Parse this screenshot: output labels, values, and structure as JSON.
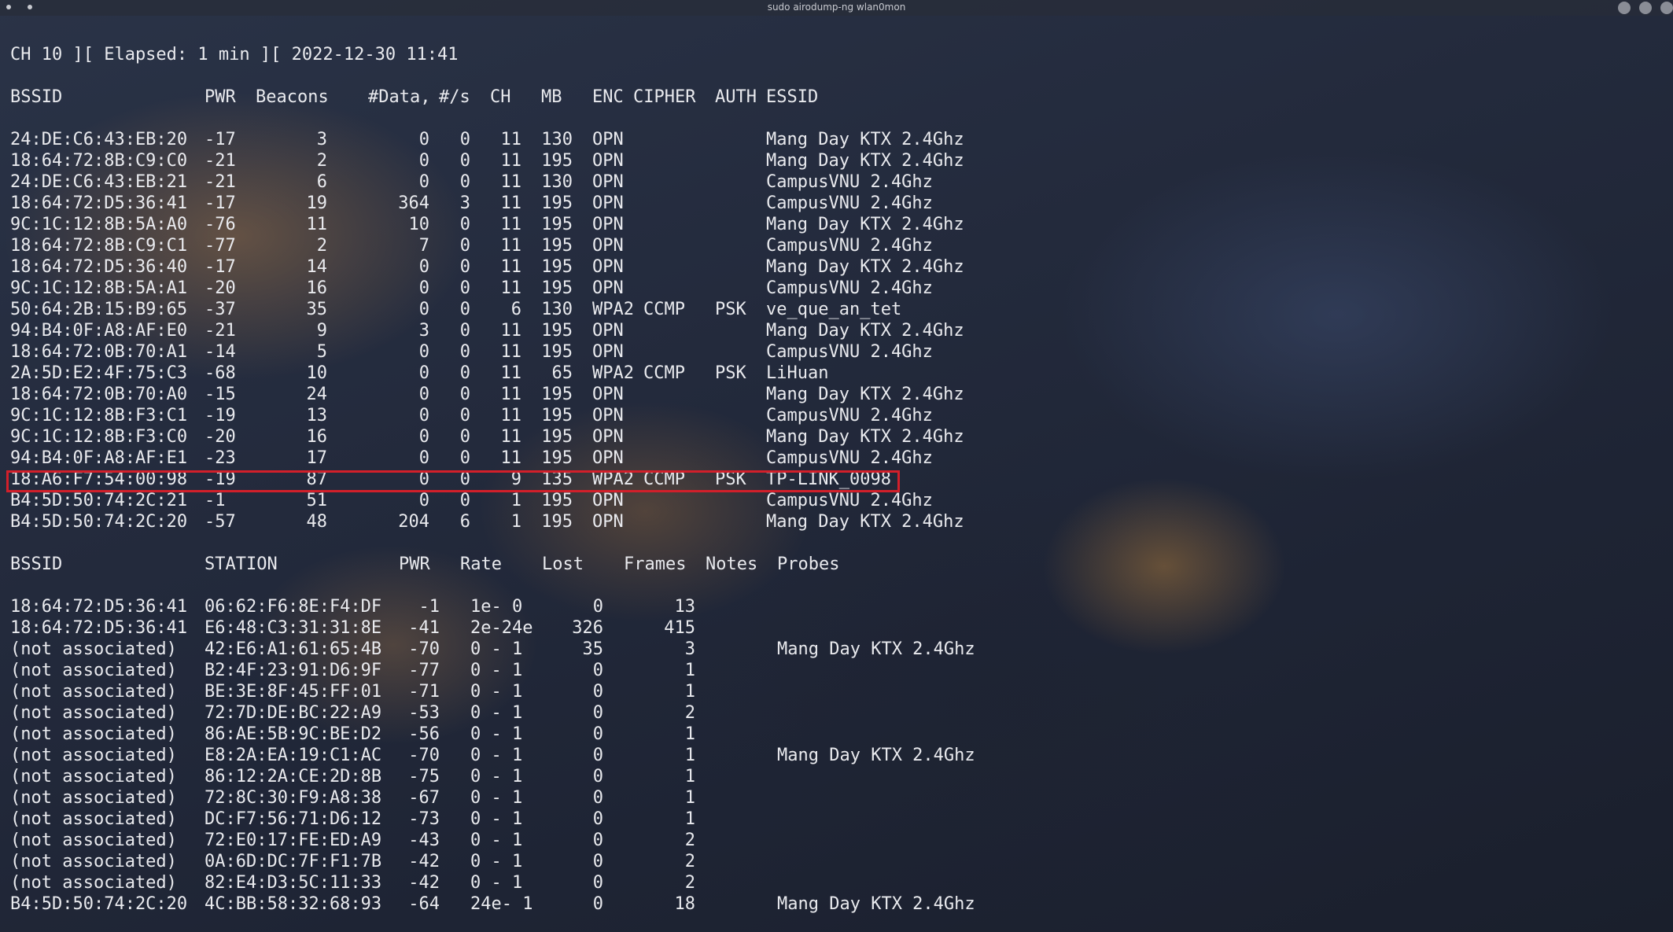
{
  "window": {
    "title": "sudo airodump-ng wlan0mon"
  },
  "status_line": "CH 10 ][ Elapsed: 1 min ][ 2022-12-30 11:41",
  "ap_table": {
    "headers": {
      "bssid": "BSSID",
      "pwr": "PWR",
      "beacons": "Beacons",
      "data": "#Data,",
      "per_sec": "#/s",
      "ch": "CH",
      "mb": "MB",
      "enc": "ENC",
      "cipher": "CIPHER",
      "auth": "AUTH",
      "essid": "ESSID"
    },
    "rows": [
      {
        "bssid": "24:DE:C6:43:EB:20",
        "pwr": "-17",
        "beacons": "3",
        "data": "0",
        "per_sec": "0",
        "ch": "11",
        "mb": "130",
        "enc": "OPN",
        "cipher": "",
        "auth": "",
        "essid": "Mang Day KTX 2.4Ghz"
      },
      {
        "bssid": "18:64:72:8B:C9:C0",
        "pwr": "-21",
        "beacons": "2",
        "data": "0",
        "per_sec": "0",
        "ch": "11",
        "mb": "195",
        "enc": "OPN",
        "cipher": "",
        "auth": "",
        "essid": "Mang Day KTX 2.4Ghz"
      },
      {
        "bssid": "24:DE:C6:43:EB:21",
        "pwr": "-21",
        "beacons": "6",
        "data": "0",
        "per_sec": "0",
        "ch": "11",
        "mb": "130",
        "enc": "OPN",
        "cipher": "",
        "auth": "",
        "essid": "CampusVNU 2.4Ghz"
      },
      {
        "bssid": "18:64:72:D5:36:41",
        "pwr": "-17",
        "beacons": "19",
        "data": "364",
        "per_sec": "3",
        "ch": "11",
        "mb": "195",
        "enc": "OPN",
        "cipher": "",
        "auth": "",
        "essid": "CampusVNU 2.4Ghz"
      },
      {
        "bssid": "9C:1C:12:8B:5A:A0",
        "pwr": "-76",
        "beacons": "11",
        "data": "10",
        "per_sec": "0",
        "ch": "11",
        "mb": "195",
        "enc": "OPN",
        "cipher": "",
        "auth": "",
        "essid": "Mang Day KTX 2.4Ghz"
      },
      {
        "bssid": "18:64:72:8B:C9:C1",
        "pwr": "-77",
        "beacons": "2",
        "data": "7",
        "per_sec": "0",
        "ch": "11",
        "mb": "195",
        "enc": "OPN",
        "cipher": "",
        "auth": "",
        "essid": "CampusVNU 2.4Ghz"
      },
      {
        "bssid": "18:64:72:D5:36:40",
        "pwr": "-17",
        "beacons": "14",
        "data": "0",
        "per_sec": "0",
        "ch": "11",
        "mb": "195",
        "enc": "OPN",
        "cipher": "",
        "auth": "",
        "essid": "Mang Day KTX 2.4Ghz"
      },
      {
        "bssid": "9C:1C:12:8B:5A:A1",
        "pwr": "-20",
        "beacons": "16",
        "data": "0",
        "per_sec": "0",
        "ch": "11",
        "mb": "195",
        "enc": "OPN",
        "cipher": "",
        "auth": "",
        "essid": "CampusVNU 2.4Ghz"
      },
      {
        "bssid": "50:64:2B:15:B9:65",
        "pwr": "-37",
        "beacons": "35",
        "data": "0",
        "per_sec": "0",
        "ch": "6",
        "mb": "130",
        "enc": "WPA2",
        "cipher": "CCMP",
        "auth": "PSK",
        "essid": "ve_que_an_tet"
      },
      {
        "bssid": "94:B4:0F:A8:AF:E0",
        "pwr": "-21",
        "beacons": "9",
        "data": "3",
        "per_sec": "0",
        "ch": "11",
        "mb": "195",
        "enc": "OPN",
        "cipher": "",
        "auth": "",
        "essid": "Mang Day KTX 2.4Ghz"
      },
      {
        "bssid": "18:64:72:0B:70:A1",
        "pwr": "-14",
        "beacons": "5",
        "data": "0",
        "per_sec": "0",
        "ch": "11",
        "mb": "195",
        "enc": "OPN",
        "cipher": "",
        "auth": "",
        "essid": "CampusVNU 2.4Ghz"
      },
      {
        "bssid": "2A:5D:E2:4F:75:C3",
        "pwr": "-68",
        "beacons": "10",
        "data": "0",
        "per_sec": "0",
        "ch": "11",
        "mb": "65",
        "enc": "WPA2",
        "cipher": "CCMP",
        "auth": "PSK",
        "essid": "LiHuan"
      },
      {
        "bssid": "18:64:72:0B:70:A0",
        "pwr": "-15",
        "beacons": "24",
        "data": "0",
        "per_sec": "0",
        "ch": "11",
        "mb": "195",
        "enc": "OPN",
        "cipher": "",
        "auth": "",
        "essid": "Mang Day KTX 2.4Ghz"
      },
      {
        "bssid": "9C:1C:12:8B:F3:C1",
        "pwr": "-19",
        "beacons": "13",
        "data": "0",
        "per_sec": "0",
        "ch": "11",
        "mb": "195",
        "enc": "OPN",
        "cipher": "",
        "auth": "",
        "essid": "CampusVNU 2.4Ghz"
      },
      {
        "bssid": "9C:1C:12:8B:F3:C0",
        "pwr": "-20",
        "beacons": "16",
        "data": "0",
        "per_sec": "0",
        "ch": "11",
        "mb": "195",
        "enc": "OPN",
        "cipher": "",
        "auth": "",
        "essid": "Mang Day KTX 2.4Ghz"
      },
      {
        "bssid": "94:B4:0F:A8:AF:E1",
        "pwr": "-23",
        "beacons": "17",
        "data": "0",
        "per_sec": "0",
        "ch": "11",
        "mb": "195",
        "enc": "OPN",
        "cipher": "",
        "auth": "",
        "essid": "CampusVNU 2.4Ghz"
      },
      {
        "bssid": "18:A6:F7:54:00:98",
        "pwr": "-19",
        "beacons": "87",
        "data": "0",
        "per_sec": "0",
        "ch": "9",
        "mb": "135",
        "enc": "WPA2",
        "cipher": "CCMP",
        "auth": "PSK",
        "essid": "TP-LINK_0098"
      },
      {
        "bssid": "B4:5D:50:74:2C:21",
        "pwr": "-1",
        "beacons": "51",
        "data": "0",
        "per_sec": "0",
        "ch": "1",
        "mb": "195",
        "enc": "OPN",
        "cipher": "",
        "auth": "",
        "essid": "CampusVNU 2.4Ghz"
      },
      {
        "bssid": "B4:5D:50:74:2C:20",
        "pwr": "-57",
        "beacons": "48",
        "data": "204",
        "per_sec": "6",
        "ch": "1",
        "mb": "195",
        "enc": "OPN",
        "cipher": "",
        "auth": "",
        "essid": "Mang Day KTX 2.4Ghz"
      }
    ]
  },
  "station_table": {
    "headers": {
      "bssid": "BSSID",
      "station": "STATION",
      "pwr": "PWR",
      "rate": "Rate",
      "lost": "Lost",
      "frames": "Frames",
      "notes": "Notes",
      "probes": "Probes"
    },
    "rows": [
      {
        "bssid": "18:64:72:D5:36:41",
        "station": "06:62:F6:8E:F4:DF",
        "pwr": "-1",
        "rate": "1e- 0",
        "lost": "0",
        "frames": "13",
        "probes": ""
      },
      {
        "bssid": "18:64:72:D5:36:41",
        "station": "E6:48:C3:31:31:8E",
        "pwr": "-41",
        "rate": "2e-24e",
        "lost": "326",
        "frames": "415",
        "probes": ""
      },
      {
        "bssid": "(not associated)",
        "station": "42:E6:A1:61:65:4B",
        "pwr": "-70",
        "rate": "0 - 1",
        "lost": "35",
        "frames": "3",
        "probes": "Mang Day KTX 2.4Ghz"
      },
      {
        "bssid": "(not associated)",
        "station": "B2:4F:23:91:D6:9F",
        "pwr": "-77",
        "rate": "0 - 1",
        "lost": "0",
        "frames": "1",
        "probes": ""
      },
      {
        "bssid": "(not associated)",
        "station": "BE:3E:8F:45:FF:01",
        "pwr": "-71",
        "rate": "0 - 1",
        "lost": "0",
        "frames": "1",
        "probes": ""
      },
      {
        "bssid": "(not associated)",
        "station": "72:7D:DE:BC:22:A9",
        "pwr": "-53",
        "rate": "0 - 1",
        "lost": "0",
        "frames": "2",
        "probes": ""
      },
      {
        "bssid": "(not associated)",
        "station": "86:AE:5B:9C:BE:D2",
        "pwr": "-56",
        "rate": "0 - 1",
        "lost": "0",
        "frames": "1",
        "probes": ""
      },
      {
        "bssid": "(not associated)",
        "station": "E8:2A:EA:19:C1:AC",
        "pwr": "-70",
        "rate": "0 - 1",
        "lost": "0",
        "frames": "1",
        "probes": "Mang Day KTX 2.4Ghz"
      },
      {
        "bssid": "(not associated)",
        "station": "86:12:2A:CE:2D:8B",
        "pwr": "-75",
        "rate": "0 - 1",
        "lost": "0",
        "frames": "1",
        "probes": ""
      },
      {
        "bssid": "(not associated)",
        "station": "72:8C:30:F9:A8:38",
        "pwr": "-67",
        "rate": "0 - 1",
        "lost": "0",
        "frames": "1",
        "probes": ""
      },
      {
        "bssid": "(not associated)",
        "station": "DC:F7:56:71:D6:12",
        "pwr": "-73",
        "rate": "0 - 1",
        "lost": "0",
        "frames": "1",
        "probes": ""
      },
      {
        "bssid": "(not associated)",
        "station": "72:E0:17:FE:ED:A9",
        "pwr": "-43",
        "rate": "0 - 1",
        "lost": "0",
        "frames": "2",
        "probes": ""
      },
      {
        "bssid": "(not associated)",
        "station": "0A:6D:DC:7F:F1:7B",
        "pwr": "-42",
        "rate": "0 - 1",
        "lost": "0",
        "frames": "2",
        "probes": ""
      },
      {
        "bssid": "(not associated)",
        "station": "82:E4:D3:5C:11:33",
        "pwr": "-42",
        "rate": "0 - 1",
        "lost": "0",
        "frames": "2",
        "probes": ""
      },
      {
        "bssid": "B4:5D:50:74:2C:20",
        "station": "4C:BB:58:32:68:93",
        "pwr": "-64",
        "rate": "24e- 1",
        "lost": "0",
        "frames": "18",
        "probes": "Mang Day KTX 2.4Ghz"
      }
    ]
  },
  "colors": {
    "highlight": "#d21f2a",
    "text": "#e9eaee"
  }
}
